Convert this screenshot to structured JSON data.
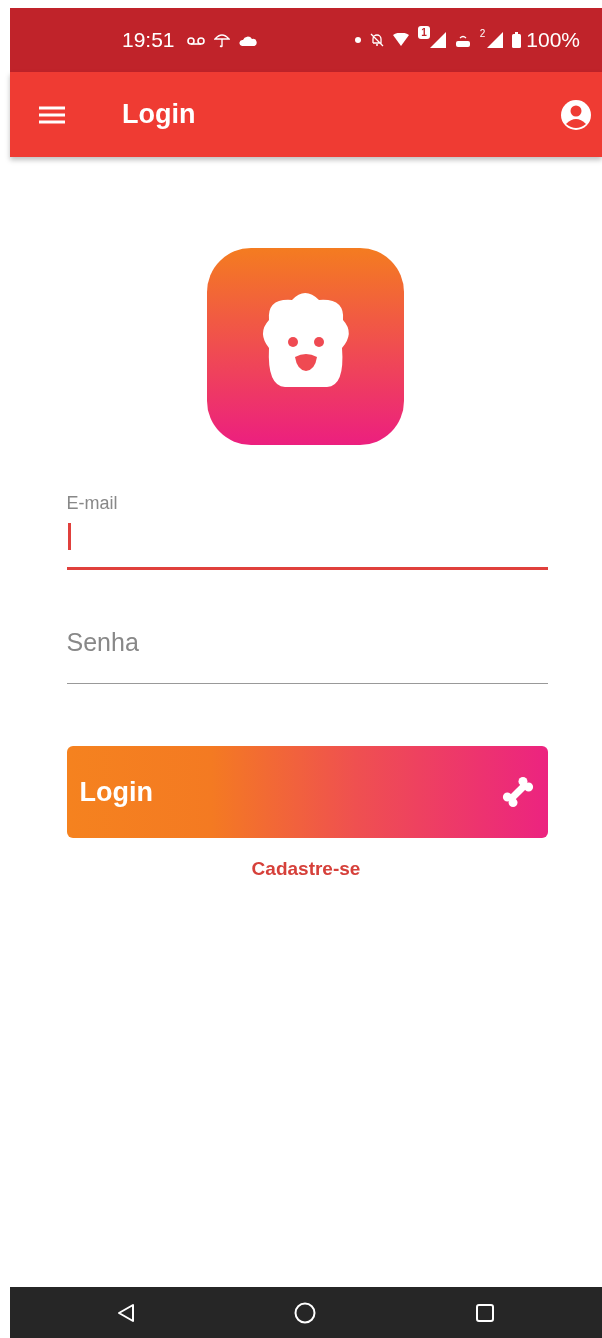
{
  "status_bar": {
    "time": "19:51",
    "sim_badge": "1",
    "sim2_badge": "2",
    "battery": "100%"
  },
  "app_bar": {
    "title": "Login"
  },
  "fields": [
    {
      "label": "E-mail",
      "focused": true
    },
    {
      "label": "Senha",
      "focused": false
    }
  ],
  "login_button": {
    "label": "Login"
  },
  "signup_link": "Cadastre-se"
}
